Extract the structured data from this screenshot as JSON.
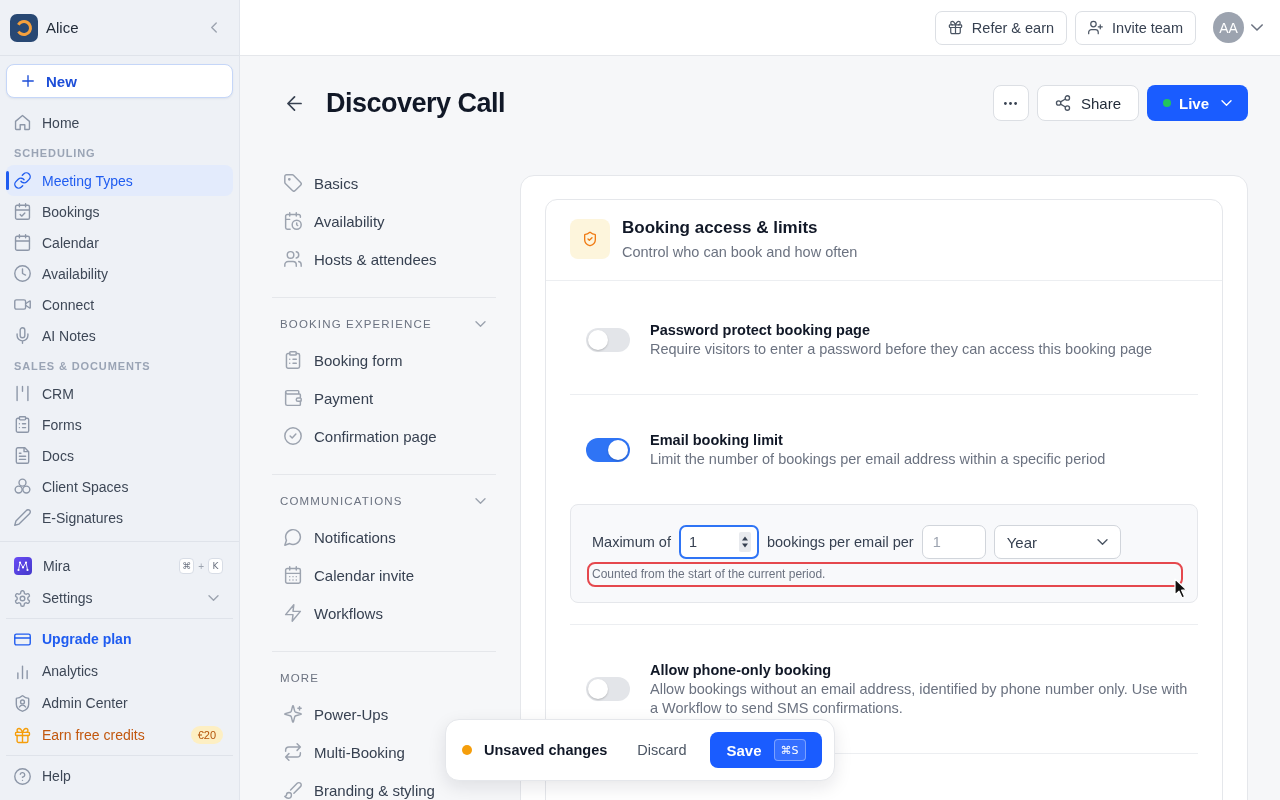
{
  "sidebar": {
    "workspace": "Alice",
    "new_button": "New",
    "groups": [
      {
        "items": [
          {
            "label": "Home",
            "selected": false
          }
        ]
      },
      {
        "label": "SCHEDULING",
        "items": [
          {
            "label": "Meeting Types",
            "selected": true
          },
          {
            "label": "Bookings",
            "selected": false
          },
          {
            "label": "Calendar",
            "selected": false
          },
          {
            "label": "Availability",
            "selected": false
          },
          {
            "label": "Connect",
            "selected": false
          },
          {
            "label": "AI Notes",
            "selected": false
          }
        ]
      },
      {
        "label": "SALES & DOCUMENTS",
        "items": [
          {
            "label": "CRM",
            "selected": false
          },
          {
            "label": "Forms",
            "selected": false
          },
          {
            "label": "Docs",
            "selected": false
          },
          {
            "label": "Client Spaces",
            "selected": false
          },
          {
            "label": "E-Signatures",
            "selected": false
          }
        ]
      }
    ],
    "footer": [
      {
        "kind": "assistant",
        "label": "Mira",
        "shortcut": [
          "⌘",
          "K"
        ],
        "shortcut_joiner": "+"
      },
      {
        "kind": "expandable",
        "label": "Settings",
        "expanded": false
      }
    ],
    "links": [
      {
        "kind": "upgrade",
        "label": "Upgrade plan"
      },
      {
        "kind": "plain",
        "label": "Analytics"
      },
      {
        "kind": "plain",
        "label": "Admin Center"
      },
      {
        "kind": "promo",
        "label": "Earn free credits",
        "badge": "€20"
      }
    ],
    "help": "Help"
  },
  "topbar": {
    "buttons": [
      "Refer & earn",
      "Invite team"
    ],
    "avatar": "AA"
  },
  "page": {
    "title": "Discovery Call",
    "share": "Share",
    "status_button": "Live"
  },
  "settings_nav": [
    {
      "items": [
        {
          "label": "Basics",
          "selected": false
        },
        {
          "label": "Availability",
          "selected": false
        },
        {
          "label": "Hosts & attendees",
          "selected": false
        }
      ]
    },
    {
      "label": "BOOKING EXPERIENCE",
      "expanded": true,
      "items": [
        {
          "label": "Booking form",
          "selected": false
        },
        {
          "label": "Payment",
          "selected": false
        },
        {
          "label": "Confirmation page",
          "selected": false
        }
      ]
    },
    {
      "label": "COMMUNICATIONS",
      "expanded": true,
      "items": [
        {
          "label": "Notifications",
          "selected": false
        },
        {
          "label": "Calendar invite",
          "selected": false
        },
        {
          "label": "Workflows",
          "selected": false
        }
      ]
    },
    {
      "label": "MORE",
      "items": [
        {
          "label": "Power-Ups",
          "selected": false
        },
        {
          "label": "Multi-Booking",
          "selected": false
        },
        {
          "label": "Branding & styling",
          "selected": false
        }
      ]
    }
  ],
  "section": {
    "title": "Booking access & limits",
    "subtitle": "Control who can book and how often",
    "settings": [
      {
        "title": "Password protect booking page",
        "description": "Require visitors to enter a password before they can access this booking page",
        "on": false
      },
      {
        "title": "Email booking limit",
        "description": "Limit the number of bookings per email address within a specific period",
        "on": true,
        "limit": {
          "label_before": "Maximum of",
          "max_bookings": {
            "value": "1",
            "focused": true
          },
          "label_between": "bookings per email per",
          "period_count": {
            "placeholder": "1",
            "focused": false
          },
          "period_unit": "Year",
          "hint": "Counted from the start of the current period.",
          "hint_highlighted": true
        }
      },
      {
        "title": "Allow phone-only booking",
        "description": "Allow bookings without an email address, identified by phone number only. Use with a Workflow to send SMS confirmations.",
        "on": false
      }
    ]
  },
  "unsaved_bar": {
    "status": "Unsaved changes",
    "discard": "Discard",
    "save": "Save",
    "save_shortcut": "⌘S"
  }
}
